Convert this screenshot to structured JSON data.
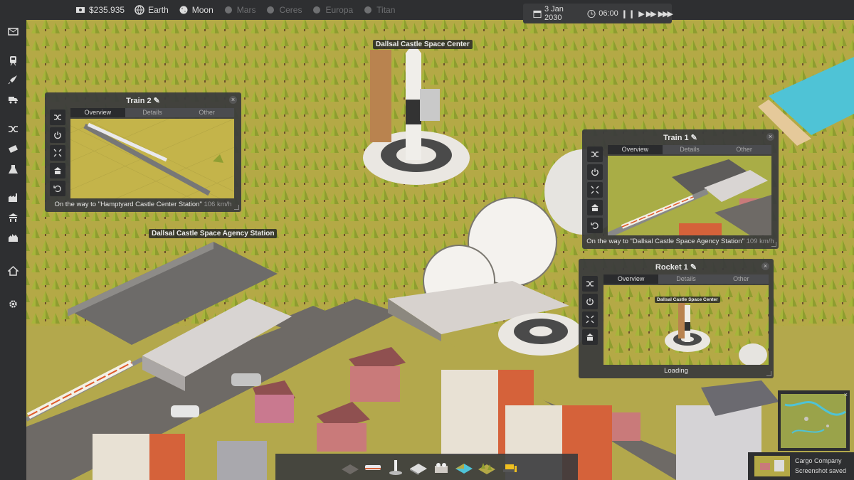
{
  "topbar": {
    "money": "$235.935",
    "planets": [
      {
        "label": "Earth",
        "active": true
      },
      {
        "label": "Moon",
        "active": true
      },
      {
        "label": "Mars",
        "active": false
      },
      {
        "label": "Ceres",
        "active": false
      },
      {
        "label": "Europa",
        "active": false
      },
      {
        "label": "Titan",
        "active": false
      }
    ],
    "date": "3 Jan 2030",
    "time": "06:00"
  },
  "world_labels": {
    "space_center": "Dallsal Castle Space Center",
    "agency_station": "Dallsal Castle Space Agency Station"
  },
  "windows": {
    "train2": {
      "title": "Train 2",
      "tabs": [
        "Overview",
        "Details",
        "Other"
      ],
      "status": "On the way to \"Hamptyard Castle Center Station\"",
      "speed": "106 km/h"
    },
    "train1": {
      "title": "Train 1",
      "tabs": [
        "Overview",
        "Details",
        "Other"
      ],
      "status": "On the way to \"Dallsal Castle Space Agency Station\"",
      "speed": "109 km/h"
    },
    "rocket1": {
      "title": "Rocket 1",
      "tabs": [
        "Overview",
        "Details",
        "Other"
      ],
      "view_label": "Dallsal Castle Space Center",
      "status": "Loading"
    }
  },
  "toast": {
    "title": "Cargo Company",
    "message": "Screenshot saved"
  },
  "icons": {
    "left": [
      "mail-icon",
      "train-icon",
      "rocket-icon",
      "truck-icon",
      "routes-icon",
      "money-icon",
      "research-icon",
      "factory-icon",
      "station-icon",
      "city-icon",
      "home-icon",
      "settings-icon"
    ]
  }
}
